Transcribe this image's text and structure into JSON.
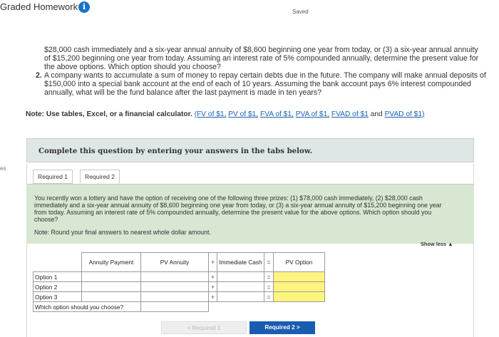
{
  "header": {
    "title": "Graded Homework",
    "info_icon": "info-icon",
    "saved": "Saved"
  },
  "question": {
    "q1_text": "$28,000 cash immediately and a six-year annual annuity of $8,600 beginning one year from today, or (3) a six-year annual annuity of $15,200 beginning one year from today. Assuming an interest rate of 5% compounded annually, determine the present value for the above options. Which option should you choose?",
    "q2_num": "2.",
    "q2_text": "A company wants to accumulate a sum of money to repay certain debts due in the future. The company will make annual deposits of $150,000 into a special bank account at the end of each of 10 years. Assuming the bank account pays 6% interest compounded annually, what will be the fund balance after the last payment is made in ten years?",
    "note_label": "Note: Use tables, Excel, or a financial calculator.",
    "links": [
      "(FV of $1,",
      "PV of $1,",
      "FVA of $1,",
      "PVA of $1,",
      "FVAD of $1",
      "and",
      "PVAD of $1)"
    ]
  },
  "complete_box": "Complete this question by entering your answers in the tabs below.",
  "side_label": "es",
  "tabs": [
    "Required 1",
    "Required 2"
  ],
  "prompt": {
    "text": "You recently won a lottery and have the option of receiving one of the following three prizes: (1) $78,000 cash immediately, (2) $28,000 cash immediately and a six-year annual annuity of $8,600 beginning one year from today, or (3) a six-year annual annuity of $15,200 beginning one year from today. Assuming an interest rate of 5% compounded annually, determine the present value for the above options. Which option should you choose?",
    "note": "Note: Round your final answers to nearest whole dollar amount."
  },
  "show_less": "Show less ▲",
  "table": {
    "headers": {
      "annuity_payment": "Annuity Payment",
      "pv_annuity": "PV Annuity",
      "op_plus": "+",
      "immediate_cash": "Immediate Cash",
      "op_eq": "=",
      "pv_option": "PV Option"
    },
    "rows": [
      {
        "label": "Option 1",
        "op1": "+",
        "op2": "="
      },
      {
        "label": "Option 2",
        "op1": "+",
        "op2": "="
      },
      {
        "label": "Option 3",
        "op1": "+",
        "op2": "="
      }
    ],
    "which_label": "Which option should you choose?"
  },
  "nav": {
    "prev": "< Required 1",
    "next": "Required 2 >"
  },
  "colors": {
    "accent": "#1a5cb0",
    "yellow_input": "#fef47f",
    "prompt_bg": "#d7e7d1"
  }
}
